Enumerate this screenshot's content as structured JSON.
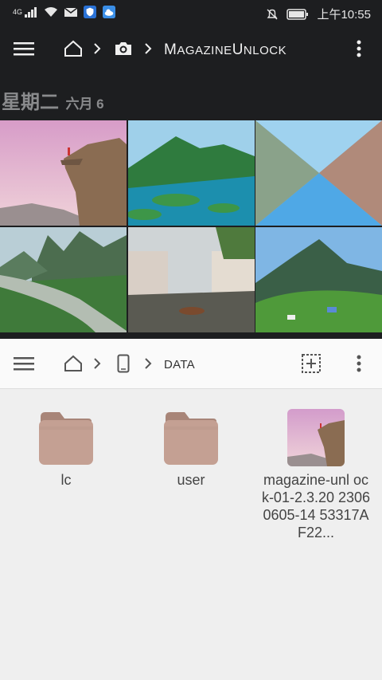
{
  "status_bar": {
    "network": "4G",
    "time": "上午10:55"
  },
  "gallery": {
    "breadcrumb": {
      "folder_first": "M",
      "folder_rest": "agazine",
      "folder_first2": "U",
      "folder_rest2": "nlock"
    },
    "date_header": {
      "day": "星期二",
      "month": "六月 6"
    },
    "thumbnails": [
      "mountain-cliff",
      "lake-islands",
      "blurred-abstract",
      "river-karst",
      "canal-village",
      "green-hills"
    ]
  },
  "file_browser": {
    "breadcrumb": {
      "folder": "DATA"
    },
    "items": [
      {
        "type": "folder",
        "name": "lc"
      },
      {
        "type": "folder",
        "name": "user"
      },
      {
        "type": "image",
        "name": "magazine-unl ock-01-2.3.20 23060605-14 53317AF22..."
      }
    ]
  },
  "colors": {
    "top_background": "#1d1e20",
    "bottom_background": "#efefef",
    "folder": "#c4a093"
  }
}
